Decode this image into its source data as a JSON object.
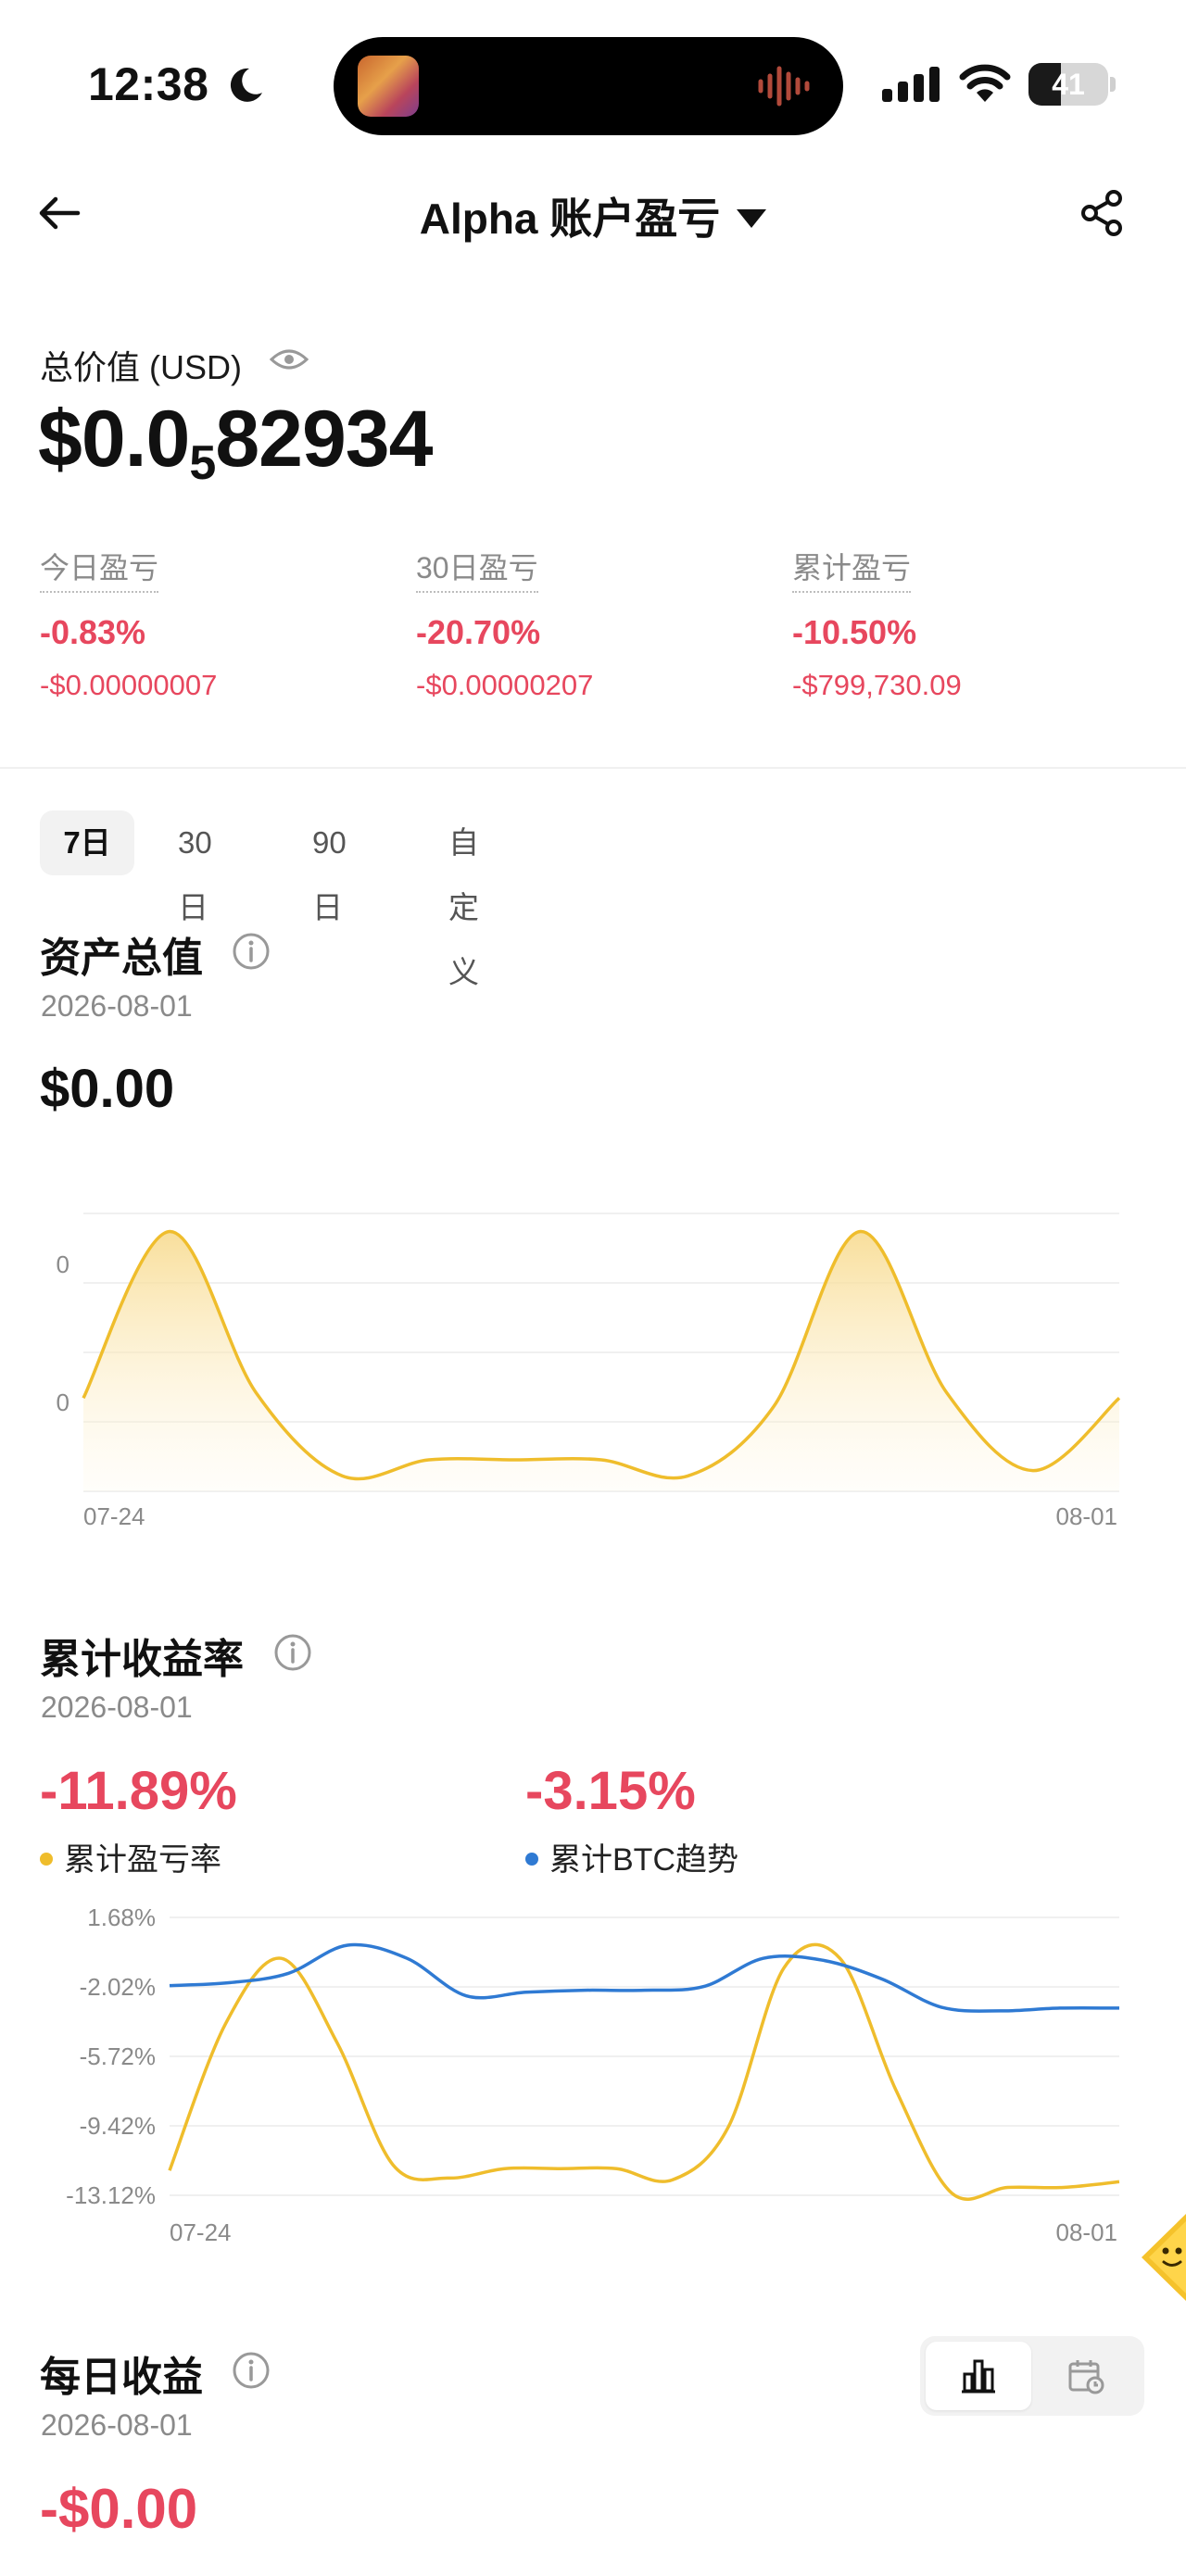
{
  "status_bar": {
    "time": "12:38",
    "battery": "41",
    "battery_level": 0.41
  },
  "nav": {
    "title": "Alpha 账户盈亏"
  },
  "summary": {
    "total_label": "总价值 (USD)",
    "total_prefix": "$0.0",
    "total_subscript": "5",
    "total_suffix": "82934",
    "stats": [
      {
        "label": "今日盈亏",
        "percent": "-0.83%",
        "amount": "-$0.00000007"
      },
      {
        "label": "30日盈亏",
        "percent": "-20.70%",
        "amount": "-$0.00000207"
      },
      {
        "label": "累计盈亏",
        "percent": "-10.50%",
        "amount": "-$799,730.09"
      }
    ]
  },
  "range_tabs": {
    "items": [
      "7日",
      "30日",
      "90日",
      "自定义"
    ],
    "active": "7日"
  },
  "asset_section": {
    "title": "资产总值",
    "date": "2026-08-01",
    "value": "$0.00",
    "chart_data": {
      "type": "area",
      "x_labels": [
        "07-24",
        "08-01"
      ],
      "y_tick_labels": [
        "0",
        "0"
      ],
      "series": [
        {
          "values": [
            0.33,
            0.95,
            0.35,
            0.04,
            0.1,
            0.1,
            0.1,
            0.04,
            0.3,
            0.95,
            0.35,
            0.06,
            0.33
          ]
        }
      ],
      "grid": true,
      "color": "#efbd2c"
    }
  },
  "return_section": {
    "title": "累计收益率",
    "date": "2026-08-01",
    "value_a": "-11.89%",
    "label_a": "累计盈亏率",
    "value_b": "-3.15%",
    "label_b": "累计BTC趋势",
    "chart_data": {
      "type": "line",
      "x_labels": [
        "07-24",
        "08-01"
      ],
      "y_tick_labels": [
        "1.68%",
        "-2.02%",
        "-5.72%",
        "-9.42%",
        "-13.12%"
      ],
      "ylim": [
        -13.12,
        1.68
      ],
      "series": [
        {
          "name": "累计盈亏率",
          "color": "#efbd2c",
          "values": [
            -11.8,
            -4.0,
            -0.5,
            -5.0,
            -11.5,
            -12.2,
            -11.7,
            -11.7,
            -11.7,
            -12.3,
            -9.5,
            -1.0,
            -0.5,
            -7.5,
            -13.0,
            -12.7,
            -12.7,
            -12.4
          ]
        },
        {
          "name": "累计BTC趋势",
          "color": "#2f7ad3",
          "values": [
            -1.95,
            -1.8,
            -1.3,
            0.2,
            -0.5,
            -2.5,
            -2.3,
            -2.2,
            -2.2,
            -2.0,
            -0.5,
            -0.6,
            -1.6,
            -3.1,
            -3.3,
            -3.15,
            -3.15
          ]
        }
      ],
      "grid": true
    }
  },
  "daily_section": {
    "title": "每日收益",
    "date": "2026-08-01",
    "value": "-$0.00"
  },
  "view_toggle": {
    "options": [
      "bar-chart-icon",
      "calendar-icon"
    ],
    "active": "bar-chart-icon"
  }
}
